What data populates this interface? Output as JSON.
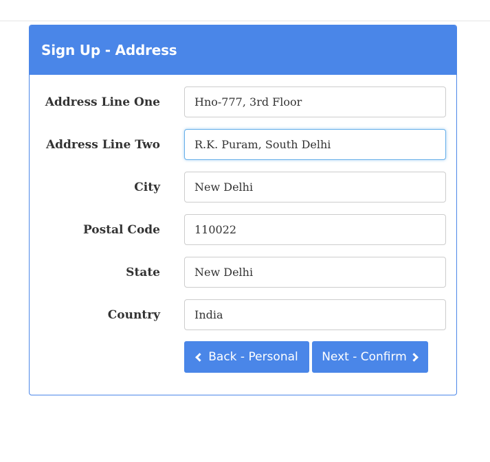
{
  "panel": {
    "title": "Sign Up - Address",
    "accent_color": "#4a86e8"
  },
  "fields": [
    {
      "label": "Address Line One",
      "value": "Hno-777, 3rd Floor"
    },
    {
      "label": "Address Line Two",
      "value": "R.K. Puram, South Delhi",
      "focused": true
    },
    {
      "label": "City",
      "value": "New Delhi"
    },
    {
      "label": "Postal Code",
      "value": "110022"
    },
    {
      "label": "State",
      "value": "New Delhi"
    },
    {
      "label": "Country",
      "value": "India"
    }
  ],
  "buttons": {
    "back_label": "Back - Personal",
    "back_icon": "chevron-left-icon",
    "next_label": "Next - Confirm",
    "next_icon": "chevron-right-icon"
  }
}
